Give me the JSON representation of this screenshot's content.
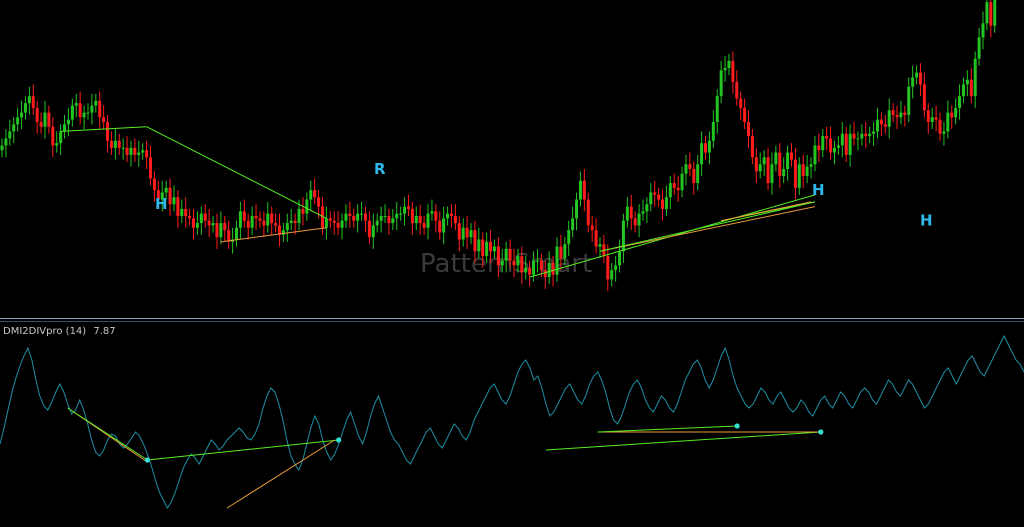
{
  "watermark": "PatternSmart",
  "indicator": {
    "name": "DMI2DIVpro (14)",
    "value": "7.87"
  },
  "pattern_labels": [
    {
      "text": "H",
      "x": 51,
      "y": 150
    },
    {
      "text": "R",
      "x": 124,
      "y": 165
    },
    {
      "text": "H",
      "x": 270,
      "y": 156
    },
    {
      "text": "H",
      "x": 306,
      "y": 143
    }
  ],
  "colors": {
    "background": "#000000",
    "bull_candle": "#22c522",
    "bear_candle": "#ff1c1c",
    "indicator_line": "#1f8fa3",
    "div_green": "#55ee22",
    "div_orange": "#e89a3c",
    "pivot_dot": "#35e0d0",
    "separator": "#8aa0c8",
    "label": "#2fb8e8"
  },
  "chart_data": [
    {
      "type": "candlestick",
      "title": "",
      "xlim": [
        0,
        345
      ],
      "ylim": [
        90,
        215
      ],
      "candles_close": [
        160,
        163,
        166,
        169,
        172,
        174,
        178,
        181,
        176,
        170,
        168,
        174,
        168,
        160,
        161,
        166,
        169,
        171,
        177,
        178,
        172,
        174,
        174,
        177,
        179,
        172,
        170,
        162,
        159,
        162,
        159,
        159,
        156,
        159,
        156,
        157,
        158,
        155,
        146,
        141,
        137,
        140,
        142,
        135,
        138,
        130,
        133,
        130,
        129,
        125,
        127,
        131,
        128,
        126,
        127,
        121,
        127,
        124,
        119,
        120,
        125,
        132,
        128,
        125,
        130,
        129,
        128,
        126,
        131,
        127,
        126,
        122,
        124,
        127,
        128,
        127,
        133,
        131,
        137,
        141,
        138,
        134,
        125,
        129,
        128,
        127,
        125,
        128,
        131,
        130,
        128,
        131,
        131,
        128,
        121,
        126,
        128,
        130,
        130,
        127,
        129,
        131,
        131,
        134,
        133,
        127,
        130,
        127,
        125,
        131,
        132,
        128,
        123,
        129,
        131,
        130,
        127,
        120,
        125,
        121,
        124,
        115,
        120,
        113,
        119,
        115,
        117,
        109,
        111,
        116,
        111,
        109,
        113,
        106,
        108,
        105,
        111,
        111,
        107,
        104,
        110,
        105,
        117,
        112,
        118,
        124,
        129,
        137,
        145,
        137,
        126,
        124,
        117,
        118,
        113,
        103,
        107,
        109,
        115,
        128,
        134,
        129,
        126,
        131,
        132,
        135,
        140,
        139,
        137,
        133,
        138,
        144,
        142,
        141,
        148,
        152,
        150,
        144,
        152,
        161,
        157,
        162,
        170,
        181,
        192,
        193,
        196,
        187,
        180,
        176,
        170,
        164,
        155,
        149,
        152,
        155,
        144,
        152,
        157,
        147,
        150,
        157,
        154,
        142,
        152,
        147,
        151,
        152,
        160,
        158,
        164,
        163,
        157,
        159,
        160,
        165,
        156,
        165,
        163,
        163,
        165,
        164,
        165,
        166,
        171,
        169,
        168,
        175,
        173,
        172,
        174,
        173,
        185,
        189,
        191,
        186,
        175,
        170,
        172,
        171,
        165,
        166,
        174,
        172,
        176,
        181,
        186,
        188,
        181,
        197,
        206,
        212,
        221,
        211,
        232,
        247,
        263,
        255,
        258,
        248,
        244,
        235
      ],
      "candles_open": [
        158,
        160,
        163,
        166,
        169,
        172,
        174,
        178,
        181,
        176,
        170,
        168,
        174,
        168,
        160,
        161,
        166,
        169,
        171,
        177,
        178,
        172,
        174,
        174,
        177,
        179,
        172,
        170,
        162,
        159,
        162,
        159,
        159,
        156,
        159,
        156,
        157,
        158,
        155,
        146,
        141,
        137,
        140,
        142,
        135,
        138,
        130,
        133,
        130,
        129,
        125,
        127,
        131,
        128,
        126,
        127,
        121,
        127,
        124,
        119,
        120,
        125,
        132,
        128,
        125,
        130,
        129,
        128,
        126,
        131,
        127,
        126,
        122,
        124,
        127,
        128,
        127,
        133,
        131,
        137,
        141,
        138,
        134,
        125,
        129,
        128,
        127,
        125,
        128,
        131,
        130,
        128,
        131,
        131,
        128,
        121,
        126,
        128,
        130,
        130,
        127,
        129,
        131,
        131,
        134,
        133,
        127,
        130,
        127,
        125,
        131,
        132,
        128,
        123,
        129,
        131,
        130,
        127,
        120,
        125,
        121,
        124,
        115,
        120,
        113,
        119,
        115,
        117,
        109,
        111,
        116,
        111,
        109,
        113,
        106,
        108,
        105,
        111,
        111,
        107,
        104,
        110,
        105,
        117,
        112,
        118,
        124,
        129,
        137,
        145,
        137,
        126,
        124,
        117,
        118,
        113,
        103,
        107,
        109,
        115,
        128,
        134,
        129,
        126,
        131,
        132,
        135,
        140,
        139,
        137,
        133,
        138,
        144,
        142,
        141,
        148,
        152,
        150,
        144,
        152,
        161,
        157,
        162,
        170,
        181,
        192,
        193,
        196,
        187,
        180,
        176,
        170,
        164,
        155,
        149,
        152,
        155,
        144,
        152,
        157,
        147,
        150,
        157,
        154,
        142,
        152,
        147,
        151,
        152,
        160,
        158,
        164,
        163,
        157,
        159,
        160,
        165,
        156,
        165,
        163,
        163,
        165,
        164,
        165,
        166,
        171,
        169,
        168,
        175,
        173,
        172,
        174,
        173,
        185,
        189,
        191,
        186,
        175,
        170,
        172,
        171,
        165,
        166,
        174,
        172,
        176,
        181,
        186,
        188,
        181,
        197,
        206,
        212,
        221,
        211,
        232,
        247,
        263,
        255,
        258,
        248,
        244
      ]
    },
    {
      "type": "line",
      "name": "DMI2DIVpro (14)",
      "ylim": [
        0,
        100
      ],
      "values": [
        38,
        46,
        55,
        64,
        71,
        77,
        82,
        86,
        80,
        70,
        62,
        57,
        55,
        59,
        64,
        68,
        64,
        58,
        53,
        55,
        60,
        55,
        48,
        40,
        34,
        32,
        35,
        40,
        43,
        42,
        38,
        36,
        38,
        41,
        44,
        42,
        38,
        33,
        27,
        20,
        14,
        10,
        6,
        9,
        14,
        20,
        26,
        30,
        33,
        31,
        28,
        32,
        36,
        40,
        38,
        35,
        37,
        40,
        42,
        44,
        46,
        44,
        41,
        40,
        43,
        48,
        56,
        62,
        66,
        64,
        58,
        50,
        40,
        32,
        28,
        25,
        30,
        38,
        46,
        52,
        48,
        40,
        34,
        30,
        33,
        38,
        44,
        50,
        54,
        48,
        42,
        38,
        44,
        52,
        58,
        62,
        56,
        50,
        44,
        40,
        38,
        34,
        30,
        28,
        32,
        36,
        40,
        44,
        46,
        42,
        38,
        36,
        40,
        44,
        48,
        46,
        42,
        40,
        44,
        50,
        54,
        58,
        62,
        66,
        68,
        64,
        60,
        58,
        62,
        68,
        74,
        78,
        80,
        76,
        70,
        72,
        66,
        58,
        52,
        54,
        58,
        62,
        66,
        68,
        64,
        60,
        58,
        62,
        68,
        72,
        74,
        70,
        64,
        56,
        50,
        48,
        52,
        58,
        64,
        68,
        70,
        66,
        60,
        56,
        54,
        58,
        62,
        60,
        56,
        54,
        58,
        64,
        70,
        74,
        78,
        80,
        76,
        70,
        66,
        70,
        76,
        82,
        86,
        80,
        72,
        66,
        62,
        58,
        56,
        58,
        62,
        66,
        64,
        60,
        58,
        62,
        64,
        60,
        56,
        54,
        56,
        60,
        58,
        54,
        52,
        56,
        60,
        62,
        58,
        56,
        60,
        64,
        62,
        58,
        56,
        60,
        64,
        66,
        64,
        60,
        58,
        62,
        66,
        70,
        68,
        64,
        62,
        66,
        70,
        68,
        64,
        60,
        56,
        58,
        62,
        66,
        70,
        74,
        76,
        72,
        68,
        72,
        76,
        80,
        82,
        78,
        74,
        72,
        76,
        80,
        84,
        88,
        92,
        88,
        84,
        80,
        78,
        74
      ]
    }
  ]
}
